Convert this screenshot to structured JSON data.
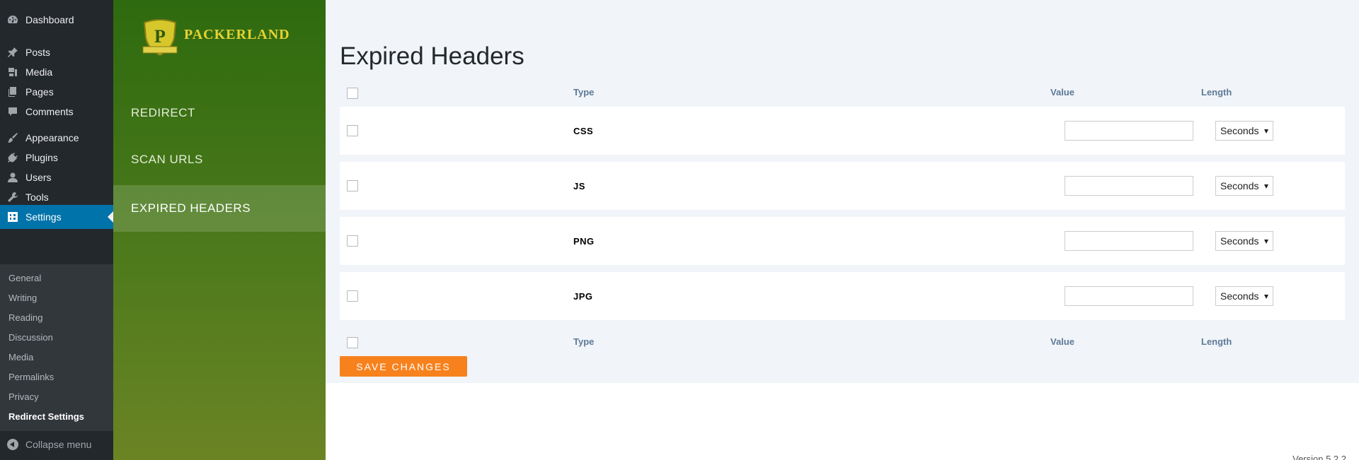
{
  "admin_menu": {
    "items": [
      {
        "label": "Dashboard",
        "icon": "dashboard-icon"
      },
      {
        "label": "Posts",
        "icon": "pushpin-icon"
      },
      {
        "label": "Media",
        "icon": "media-icon"
      },
      {
        "label": "Pages",
        "icon": "pages-icon"
      },
      {
        "label": "Comments",
        "icon": "comment-icon"
      },
      {
        "label": "Appearance",
        "icon": "paintbrush-icon"
      },
      {
        "label": "Plugins",
        "icon": "plugin-icon"
      },
      {
        "label": "Users",
        "icon": "user-icon"
      },
      {
        "label": "Tools",
        "icon": "wrench-icon"
      },
      {
        "label": "Settings",
        "icon": "settings-icon"
      }
    ],
    "submenu": [
      "General",
      "Writing",
      "Reading",
      "Discussion",
      "Media",
      "Permalinks",
      "Privacy",
      "Redirect Settings"
    ],
    "collapse_label": "Collapse menu"
  },
  "plugin": {
    "brand": "PACKERLAND",
    "nav": [
      "REDIRECT",
      "SCAN URLS",
      "EXPIRED HEADERS"
    ]
  },
  "page": {
    "title": "Expired Headers",
    "columns": {
      "type": "Type",
      "value": "Value",
      "length": "Length"
    },
    "rows": [
      {
        "type": "CSS",
        "value": "",
        "length": "Seconds"
      },
      {
        "type": "JS",
        "value": "",
        "length": "Seconds"
      },
      {
        "type": "PNG",
        "value": "",
        "length": "Seconds"
      },
      {
        "type": "JPG",
        "value": "",
        "length": "Seconds"
      }
    ],
    "save_label": "SAVE CHANGES",
    "version": "Version 5.2.2"
  },
  "colors": {
    "admin_bg": "#23282d",
    "active_menu": "#0073aa",
    "plugin_green": "#2e6a0f",
    "save_orange": "#f7821d"
  }
}
